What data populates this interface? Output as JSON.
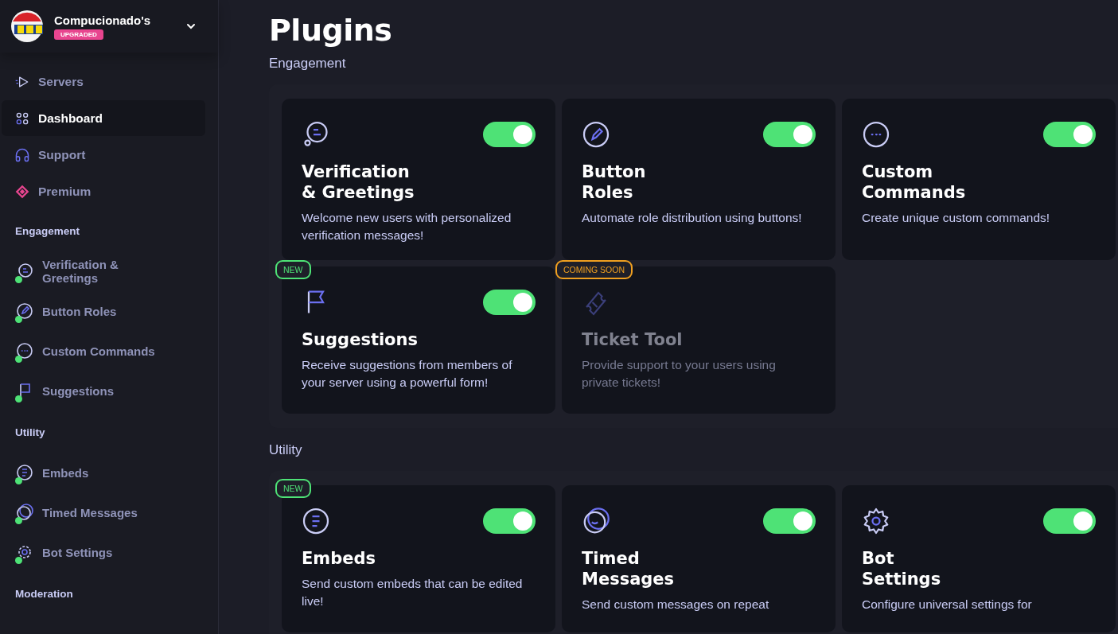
{
  "server": {
    "name": "Compucionado's",
    "badge": "UPGRADED"
  },
  "nav": [
    {
      "label": "Servers",
      "selected": false
    },
    {
      "label": "Dashboard",
      "selected": true
    },
    {
      "label": "Support",
      "selected": false
    },
    {
      "label": "Premium",
      "selected": false
    }
  ],
  "sidebar_sections": [
    {
      "title": "Engagement",
      "items": [
        {
          "label": "Verification & Greetings",
          "enabled": true
        },
        {
          "label": "Button Roles",
          "enabled": true
        },
        {
          "label": "Custom Commands",
          "enabled": true
        },
        {
          "label": "Suggestions",
          "enabled": true
        }
      ]
    },
    {
      "title": "Utility",
      "items": [
        {
          "label": "Embeds",
          "enabled": true
        },
        {
          "label": "Timed Messages",
          "enabled": true
        },
        {
          "label": "Bot Settings",
          "enabled": true
        }
      ]
    },
    {
      "title": "Moderation"
    }
  ],
  "page_title": "Plugins",
  "sections": [
    {
      "title": "Engagement",
      "cards": [
        {
          "title_lines": [
            "Verification",
            "& Greetings"
          ],
          "description": "Welcome new users with personalized verification messages!",
          "toggle": {
            "on": true
          },
          "disabled": false
        },
        {
          "title_lines": [
            "Button",
            "Roles"
          ],
          "description": "Automate role distribution using buttons!",
          "toggle": {
            "on": true
          },
          "disabled": false
        },
        {
          "title_lines": [
            "Custom",
            "Commands"
          ],
          "description": "Create unique custom commands!",
          "toggle": {
            "on": true
          },
          "disabled": false
        },
        {
          "title_lines": [
            "Suggestions"
          ],
          "description": "Receive suggestions from members of your server using a powerful form!",
          "toggle": {
            "on": true
          },
          "disabled": false,
          "badge": {
            "label": "NEW",
            "kind": "new"
          }
        },
        {
          "title_lines": [
            "Ticket Tool"
          ],
          "description": "Provide support to your users using private tickets!",
          "disabled": true,
          "badge": {
            "label": "COMING SOON",
            "kind": "soon"
          }
        }
      ]
    },
    {
      "title": "Utility",
      "cards": [
        {
          "title_lines": [
            "Embeds"
          ],
          "description": "Send custom embeds that can be edited live!",
          "toggle": {
            "on": true
          },
          "disabled": false,
          "badge": {
            "label": "NEW",
            "kind": "new"
          }
        },
        {
          "title_lines": [
            "Timed",
            "Messages"
          ],
          "description": "Send custom messages on repeat",
          "toggle": {
            "on": true
          },
          "disabled": false
        },
        {
          "title_lines": [
            "Bot",
            "Settings"
          ],
          "description": "Configure universal settings for",
          "toggle": {
            "on": true
          },
          "disabled": false
        }
      ]
    }
  ]
}
